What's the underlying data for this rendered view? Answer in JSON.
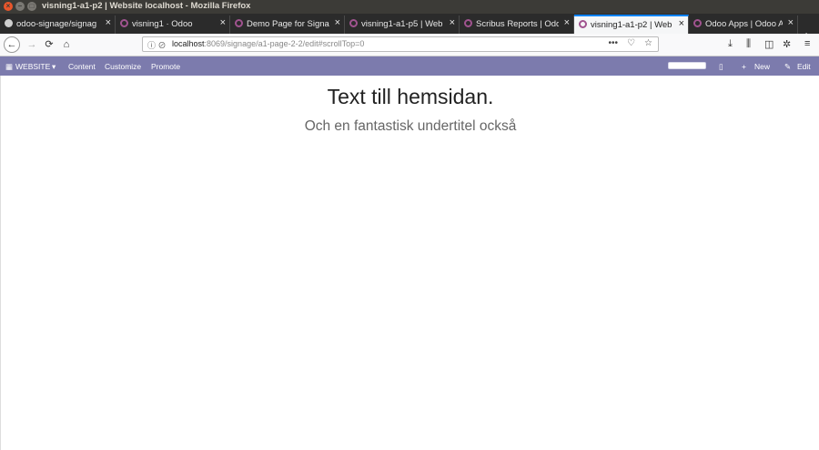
{
  "window": {
    "title": "visning1-a1-p2 | Website localhost - Mozilla Firefox"
  },
  "tabs": [
    {
      "label": "odoo-signage/signag",
      "icon": "github-icon",
      "active": false
    },
    {
      "label": "visning1 · Odoo",
      "icon": "odoo-icon",
      "active": false
    },
    {
      "label": "Demo Page for Signa",
      "icon": "odoo-icon",
      "active": false
    },
    {
      "label": "visning1-a1-p5 | Web",
      "icon": "odoo-icon",
      "active": false
    },
    {
      "label": "Scribus Reports | Odo",
      "icon": "odoo-icon",
      "active": false
    },
    {
      "label": "visning1-a1-p2 | Web",
      "icon": "odoo-icon",
      "active": true
    },
    {
      "label": "Odoo Apps | Odoo Ap",
      "icon": "odoo-icon",
      "active": false
    }
  ],
  "urlbar": {
    "host": "localhost",
    "path": ":8069/signage/a1-page-2-2/edit#scrollTop=0"
  },
  "odoo": {
    "website_menu": "WEBSITE",
    "content": "Content",
    "customize": "Customize",
    "promote": "Promote",
    "new": "New",
    "edit": "Edit"
  },
  "page": {
    "title": "Text till hemsidan.",
    "subtitle": "Och en fantastisk undertitel också"
  },
  "colors": {
    "odoo_bar": "#7c7bad",
    "active_tab_accent": "#0a84ff",
    "titlebar": "#3c3b37"
  }
}
